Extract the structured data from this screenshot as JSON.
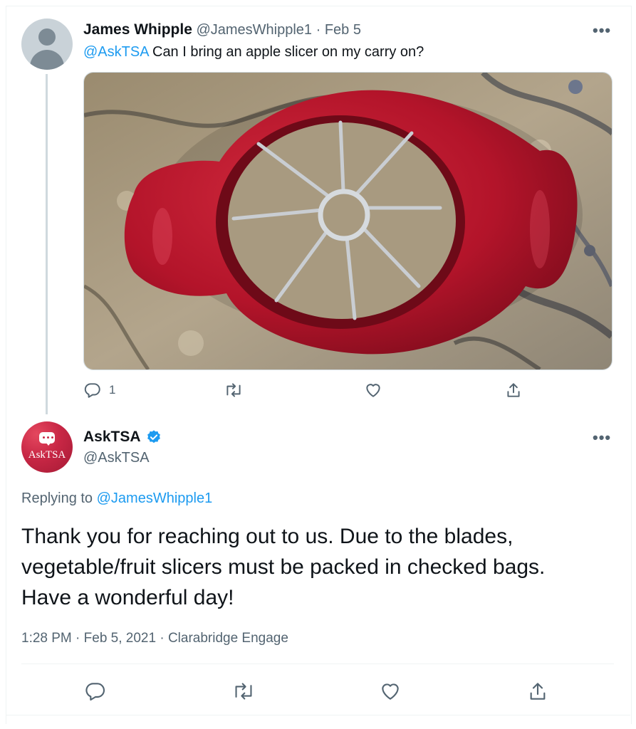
{
  "original_tweet": {
    "author_name": "James Whipple",
    "author_handle": "@JamesWhipple1",
    "separator": "·",
    "date": "Feb 5",
    "mention": "@AskTSA",
    "text": " Can I bring an apple slicer on my carry on?",
    "more_label": "•••",
    "reply_count": "1"
  },
  "reply_tweet": {
    "author_name": "AskTSA",
    "author_handle": "@AskTSA",
    "avatar_text": "AskTSA",
    "more_label": "•••",
    "replying_prefix": "Replying to ",
    "replying_to": "@JamesWhipple1",
    "text_line1": "Thank you for reaching out to us. Due to the blades,",
    "text_line2": "vegetable/fruit slicers must be packed in checked bags.",
    "text_line3": "Have a wonderful day!",
    "timestamp": "1:28 PM · Feb 5, 2021 · Clarabridge Engage"
  },
  "colors": {
    "accent": "#1d9bf0",
    "muted": "#536471",
    "slicer_red": "#b3142a"
  },
  "icons": [
    "reply-icon",
    "retweet-icon",
    "like-icon",
    "share-icon",
    "verified-badge-icon",
    "more-icon"
  ]
}
